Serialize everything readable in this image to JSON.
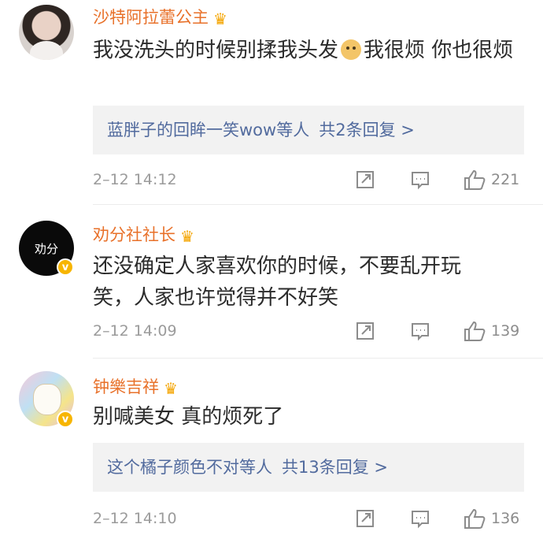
{
  "comments": [
    {
      "username": "沙特阿拉蕾公主",
      "text_part1": "我没洗头的时候别揉我头发",
      "emoji": "doge-emoji",
      "text_part2": "我很烦  你也很烦",
      "replies": {
        "preview": "蓝胖子的回眸一笑wow等人",
        "count_label": "共2条回复 >"
      },
      "timestamp": "2–12 14:12",
      "likes": "221"
    },
    {
      "username": "劝分社社长",
      "avatar_text": "劝分",
      "verified": true,
      "text": "还没确定人家喜欢你的时候，不要乱开玩笑，人家也许觉得并不好笑",
      "timestamp": "2–12 14:09",
      "likes": "139"
    },
    {
      "username": "钟樂吉祥",
      "verified": true,
      "text": "别喊美女 真的烦死了",
      "replies": {
        "preview": "这个橘子颜色不对等人",
        "count_label": "共13条回复 >"
      },
      "timestamp": "2–12 14:10",
      "likes": "136"
    }
  ],
  "icons": {
    "crown": "crown-icon",
    "share": "share-icon",
    "comment": "comment-icon",
    "like": "thumbs-up-icon",
    "verified": "verified-badge-icon"
  },
  "colors": {
    "username": "#e8712a",
    "reply_link": "#526b9e",
    "meta_gray": "#9b9b9b",
    "verified": "#f7b500"
  }
}
